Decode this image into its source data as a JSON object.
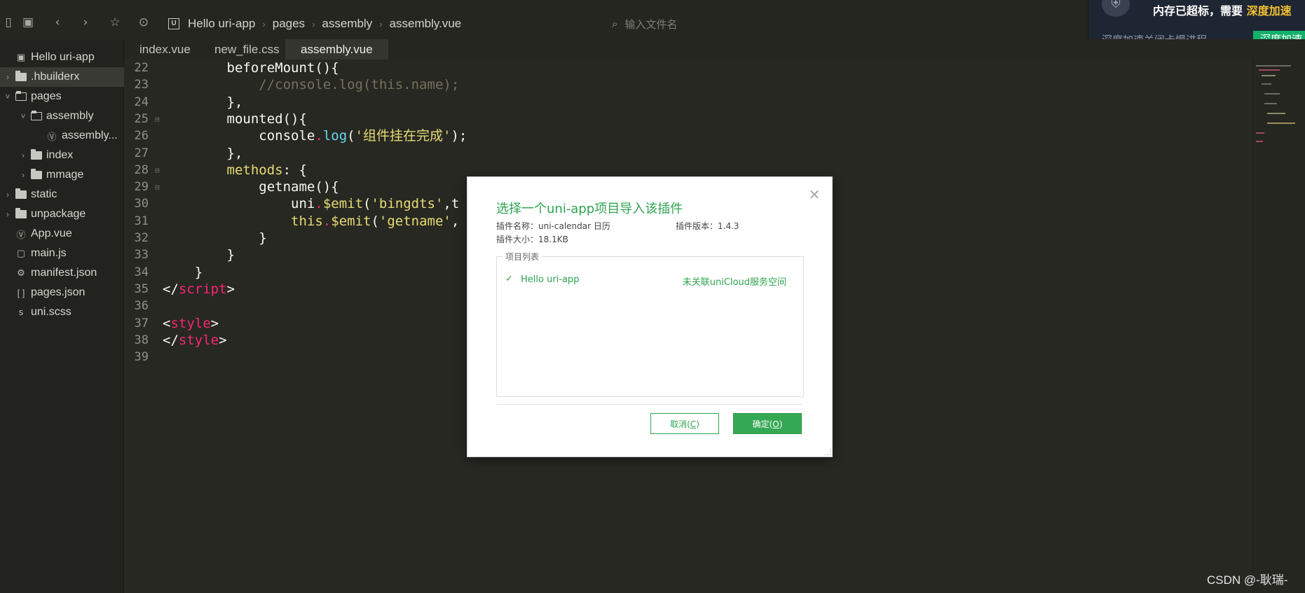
{
  "toolbar": {
    "breadcrumb": [
      "Hello uri-app",
      "pages",
      "assembly",
      "assembly.vue"
    ],
    "project_badge": "U",
    "file_search_placeholder": "输入文件名"
  },
  "notification": {
    "message_prefix": "内存已超标，需要",
    "message_highlight": "深度加速",
    "sub_text": "深度加速关闭卡慢进程",
    "button_label": "深度加速"
  },
  "sidebar": {
    "items": [
      {
        "label": "Hello uri-app",
        "type": "project",
        "indent": 0,
        "chevron": "",
        "selected": false
      },
      {
        "label": ".hbuilderx",
        "type": "folder",
        "indent": 0,
        "chevron": "›",
        "selected": true
      },
      {
        "label": "pages",
        "type": "folder-open",
        "indent": 0,
        "chevron": "˅",
        "selected": false
      },
      {
        "label": "assembly",
        "type": "folder-open",
        "indent": 1,
        "chevron": "˅",
        "selected": false
      },
      {
        "label": "assembly...",
        "type": "vue",
        "indent": 2,
        "chevron": "",
        "selected": false
      },
      {
        "label": "index",
        "type": "folder",
        "indent": 1,
        "chevron": "›",
        "selected": false
      },
      {
        "label": "mmage",
        "type": "folder",
        "indent": 1,
        "chevron": "›",
        "selected": false
      },
      {
        "label": "static",
        "type": "folder",
        "indent": 0,
        "chevron": "›",
        "selected": false
      },
      {
        "label": "unpackage",
        "type": "folder",
        "indent": 0,
        "chevron": "›",
        "selected": false
      },
      {
        "label": "App.vue",
        "type": "vue",
        "indent": 0,
        "chevron": "",
        "selected": false
      },
      {
        "label": "main.js",
        "type": "js",
        "indent": 0,
        "chevron": "",
        "selected": false
      },
      {
        "label": "manifest.json",
        "type": "manifest",
        "indent": 0,
        "chevron": "",
        "selected": false
      },
      {
        "label": "pages.json",
        "type": "json",
        "indent": 0,
        "chevron": "",
        "selected": false
      },
      {
        "label": "uni.scss",
        "type": "scss",
        "indent": 0,
        "chevron": "",
        "selected": false
      }
    ]
  },
  "tabs": [
    {
      "label": "index.vue",
      "active": false
    },
    {
      "label": "new_file.css",
      "active": false
    },
    {
      "label": "assembly.vue",
      "active": true
    }
  ],
  "editor": {
    "lines": [
      {
        "n": "22",
        "fold": "",
        "tokens": [
          [
            "        ",
            "pun"
          ],
          [
            "beforeMount(){",
            "pun"
          ]
        ]
      },
      {
        "n": "23",
        "fold": "",
        "tokens": [
          [
            "            ",
            "pun"
          ],
          [
            "//console.log(this.name);",
            "cmt"
          ]
        ]
      },
      {
        "n": "24",
        "fold": "",
        "tokens": [
          [
            "        ",
            "pun"
          ],
          [
            "},",
            "pun"
          ]
        ]
      },
      {
        "n": "25",
        "fold": "⊟",
        "tokens": [
          [
            "        ",
            "pun"
          ],
          [
            "mounted(){",
            "pun"
          ]
        ]
      },
      {
        "n": "26",
        "fold": "",
        "tokens": [
          [
            "            ",
            "pun"
          ],
          [
            "console",
            "pun"
          ],
          [
            ".",
            "tag"
          ],
          [
            "log",
            "fn"
          ],
          [
            "(",
            "pun"
          ],
          [
            "'组件挂在完成'",
            "str"
          ],
          [
            ");",
            "pun"
          ]
        ]
      },
      {
        "n": "27",
        "fold": "",
        "tokens": [
          [
            "        ",
            "pun"
          ],
          [
            "},",
            "pun"
          ]
        ]
      },
      {
        "n": "28",
        "fold": "⊟",
        "tokens": [
          [
            "        ",
            "pun"
          ],
          [
            "methods",
            "key"
          ],
          [
            ": {",
            "pun"
          ]
        ]
      },
      {
        "n": "29",
        "fold": "⊟",
        "tokens": [
          [
            "            ",
            "pun"
          ],
          [
            "getname(){",
            "pun"
          ]
        ]
      },
      {
        "n": "30",
        "fold": "",
        "tokens": [
          [
            "                ",
            "pun"
          ],
          [
            "uni",
            "pun"
          ],
          [
            ".",
            "tag"
          ],
          [
            "$emit",
            "key"
          ],
          [
            "(",
            "pun"
          ],
          [
            "'bingdts'",
            "str"
          ],
          [
            ",t",
            "pun"
          ]
        ]
      },
      {
        "n": "31",
        "fold": "",
        "tokens": [
          [
            "                ",
            "pun"
          ],
          [
            "this",
            "key"
          ],
          [
            ".",
            "tag"
          ],
          [
            "$emit",
            "key"
          ],
          [
            "(",
            "pun"
          ],
          [
            "'getname'",
            "str"
          ],
          [
            ",",
            "pun"
          ]
        ]
      },
      {
        "n": "32",
        "fold": "",
        "tokens": [
          [
            "            ",
            "pun"
          ],
          [
            "}",
            "pun"
          ]
        ]
      },
      {
        "n": "33",
        "fold": "",
        "tokens": [
          [
            "        ",
            "pun"
          ],
          [
            "}",
            "pun"
          ]
        ]
      },
      {
        "n": "34",
        "fold": "",
        "tokens": [
          [
            "    ",
            "pun"
          ],
          [
            "}",
            "pun"
          ]
        ]
      },
      {
        "n": "35",
        "fold": "",
        "tokens": [
          [
            "</",
            "pun"
          ],
          [
            "script",
            "tag"
          ],
          [
            ">",
            "pun"
          ]
        ]
      },
      {
        "n": "36",
        "fold": "",
        "tokens": []
      },
      {
        "n": "37",
        "fold": "",
        "tokens": [
          [
            "<",
            "pun"
          ],
          [
            "style",
            "tag"
          ],
          [
            ">",
            "pun"
          ]
        ]
      },
      {
        "n": "38",
        "fold": "",
        "tokens": [
          [
            "</",
            "pun"
          ],
          [
            "style",
            "tag"
          ],
          [
            ">",
            "pun"
          ]
        ]
      },
      {
        "n": "39",
        "fold": "",
        "tokens": []
      }
    ]
  },
  "dialog": {
    "title": "选择一个uni-app项目导入该插件",
    "plugin_name_label": "插件名称：uni-calendar 日历",
    "plugin_version_label": "插件版本：1.4.3",
    "plugin_size_label": "插件大小：18.1KB",
    "group_legend": "项目列表",
    "project_name": "Hello uri-app",
    "project_status": "未关联uniCloud服务空间",
    "cancel_label": "取消(",
    "cancel_key": "C",
    "ok_label": "确定(",
    "ok_key": "O",
    "close_symbol": "✕"
  },
  "watermark": "CSDN @-耿瑞-",
  "colors": {
    "accent_green": "#2ea44f",
    "notify_highlight": "#f2c230",
    "editor_bg": "#272822"
  }
}
